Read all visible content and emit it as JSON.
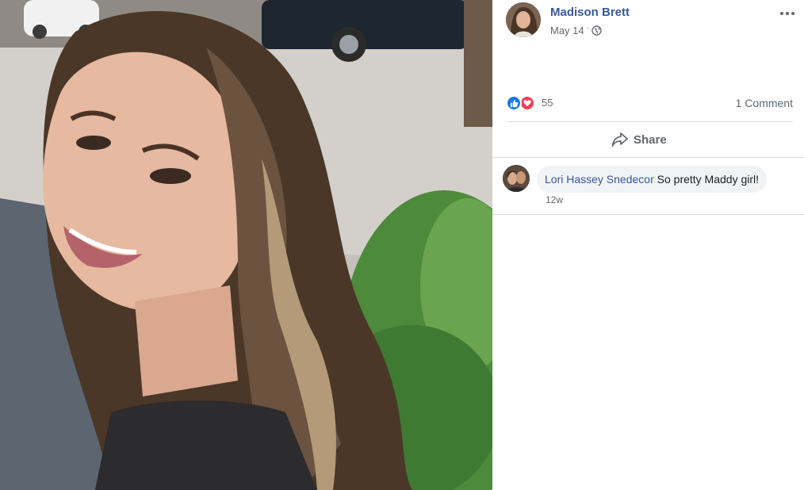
{
  "post": {
    "author_name": "Madison Brett",
    "date": "May 14",
    "date_separator": "·",
    "privacy_icon": "globe-icon",
    "more_icon": "more-options-icon"
  },
  "reactions": {
    "icons": [
      "like-icon",
      "love-icon"
    ],
    "count": "55",
    "comments_label": "1 Comment"
  },
  "actions": {
    "share_label": "Share",
    "share_icon": "share-arrow-icon"
  },
  "comments": [
    {
      "author": "Lori Hassey Snedecor",
      "text": "So pretty Maddy girl!",
      "time": "12w"
    }
  ],
  "colors": {
    "link": "#385898",
    "secondary_text": "#606770",
    "like_blue": "#1877f2",
    "love_red": "#f33e58",
    "divider": "#dadde1",
    "comment_bubble": "#f2f3f5"
  }
}
